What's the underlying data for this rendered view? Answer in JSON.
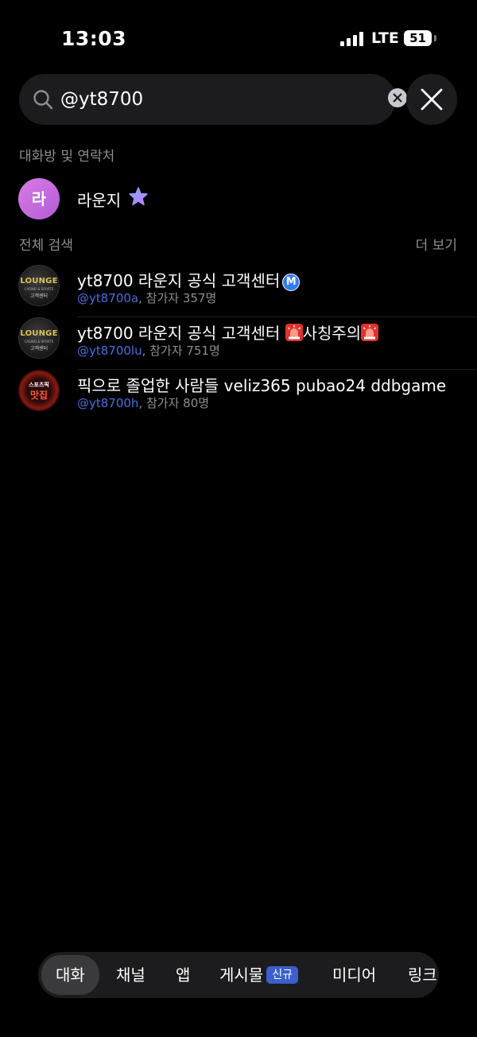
{
  "status_bar": {
    "time": "13:03",
    "network": "LTE",
    "battery_level": "51"
  },
  "search": {
    "query": "@yt8700",
    "placeholder": ""
  },
  "sections": {
    "contacts_title": "대화방 및 연락처",
    "all_search_title": "전체 검색",
    "more_label": "더 보기"
  },
  "contact": {
    "avatar_text": "라",
    "name": "라운지",
    "avatar_color": "#C866DD"
  },
  "results": [
    {
      "title": "yt8700 라운지 공식 고객센터",
      "badge": "M",
      "handle": "@yt8700a",
      "participants": ", 참가자 357명",
      "avatar_brand": "LOUNGE",
      "avatar_tagline": "CASINO & SPORTS",
      "avatar_sub": "고객센터"
    },
    {
      "title": "yt8700 라운지 공식 고객센터",
      "title_suffix": "사칭주의",
      "handle": "@yt8700lu",
      "participants": ", 참가자 751명",
      "avatar_brand": "LOUNGE",
      "avatar_tagline": "CASINO & SPORTS",
      "avatar_sub": "고객센터"
    },
    {
      "title": "픽으로 졸업한 사람들 veliz365 pubao24 ddbgame",
      "handle": "@yt8700h",
      "participants": ", 참가자 80명",
      "avatar_top": "스포츠픽",
      "avatar_main": "맛집"
    }
  ],
  "tabs": [
    {
      "label": "대화",
      "active": true
    },
    {
      "label": "채널"
    },
    {
      "label": "앱"
    },
    {
      "label": "게시물",
      "badge": "신규"
    },
    {
      "label": "미디어"
    },
    {
      "label": "링크"
    }
  ],
  "colors": {
    "background": "#000000",
    "surface": "#1C1C1E",
    "handle_link": "#4A6EE0",
    "secondary_text": "#8E8E93",
    "new_badge": "#3B5FCC"
  }
}
